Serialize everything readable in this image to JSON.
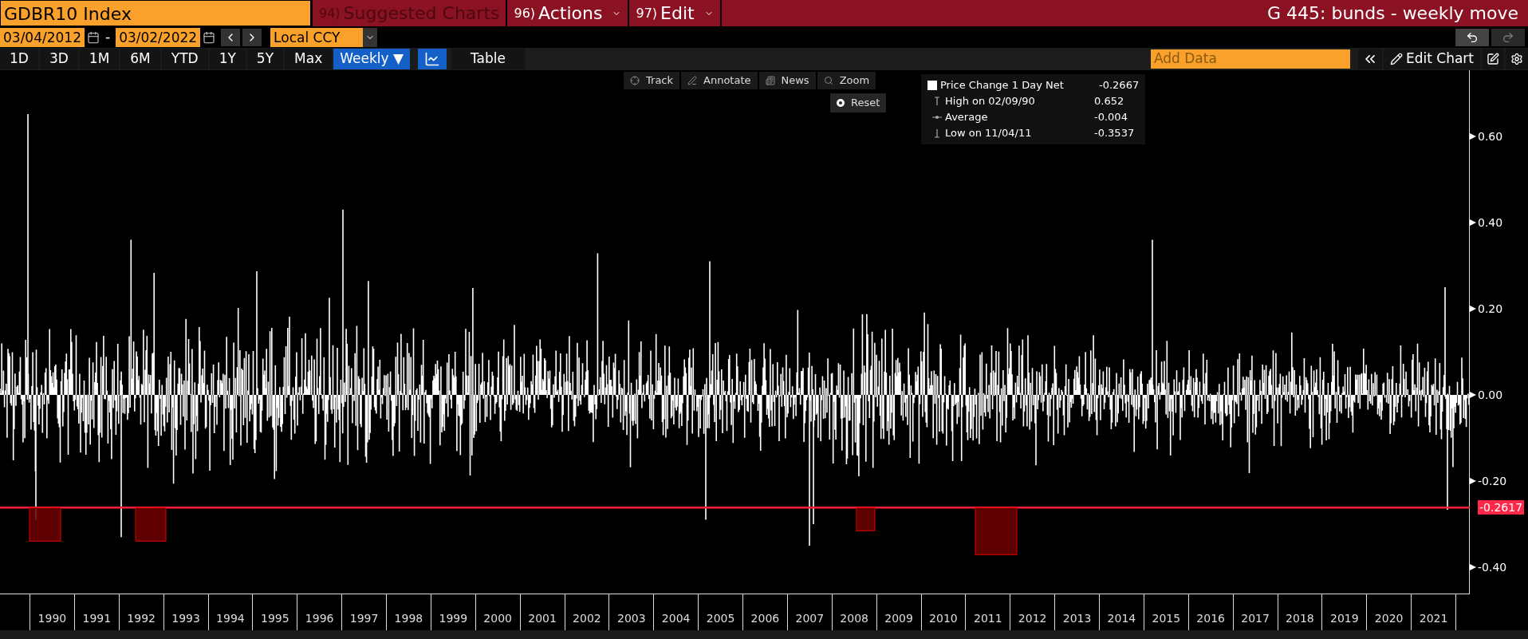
{
  "header": {
    "security": "GDBR10 Index",
    "menu_buttons": [
      {
        "number": "94)",
        "label": "Suggested Charts",
        "disabled": true,
        "caret": false
      },
      {
        "number": "96)",
        "label": "Actions",
        "disabled": false,
        "caret": true
      },
      {
        "number": "97)",
        "label": "Edit",
        "disabled": false,
        "caret": true
      }
    ],
    "title": "G 445: bunds - weekly move"
  },
  "date_range": {
    "start": "03/04/2012",
    "separator": "-",
    "end": "03/02/2022",
    "currency": "Local CCY"
  },
  "periods": [
    {
      "label": "1D",
      "selected": false
    },
    {
      "label": "3D",
      "selected": false
    },
    {
      "label": "1M",
      "selected": false
    },
    {
      "label": "6M",
      "selected": false
    },
    {
      "label": "YTD",
      "selected": false
    },
    {
      "label": "1Y",
      "selected": false
    },
    {
      "label": "5Y",
      "selected": false
    },
    {
      "label": "Max",
      "selected": false
    }
  ],
  "frequency": {
    "label": "Weekly",
    "caret": "▼",
    "selected": true
  },
  "views": [
    {
      "kind": "chart",
      "selected": true
    },
    {
      "kind": "table",
      "label": "Table",
      "selected": false
    }
  ],
  "add_data": {
    "placeholder": "Add Data"
  },
  "edit_chart": "Edit Chart",
  "chart_tools": [
    {
      "kind": "track",
      "label": "Track"
    },
    {
      "kind": "annotate",
      "label": "Annotate"
    },
    {
      "kind": "news",
      "label": "News"
    },
    {
      "kind": "zoom",
      "label": "Zoom"
    }
  ],
  "reset": "Reset",
  "legend": {
    "series": "Price Change 1 Day Net",
    "value": "-0.2667",
    "rows": [
      {
        "kind": "high",
        "label": "High on 02/09/90",
        "value": "0.652"
      },
      {
        "kind": "average",
        "label": "Average",
        "value": "-0.004"
      },
      {
        "kind": "low",
        "label": "Low on 11/04/11",
        "value": "-0.3537"
      }
    ]
  },
  "y_axis": {
    "ticks": [
      "0.60",
      "0.40",
      "0.20",
      "0.00",
      "-0.20",
      "-0.40"
    ],
    "threshold": "-0.2617"
  },
  "x_axis": {
    "years": [
      "1990",
      "1991",
      "1992",
      "1993",
      "1994",
      "1995",
      "1996",
      "1997",
      "1998",
      "1999",
      "2000",
      "2001",
      "2002",
      "2003",
      "2004",
      "2005",
      "2006",
      "2007",
      "2008",
      "2009",
      "2010",
      "2011",
      "2012",
      "2013",
      "2014",
      "2015",
      "2016",
      "2017",
      "2018",
      "2019",
      "2020",
      "2021"
    ]
  }
}
